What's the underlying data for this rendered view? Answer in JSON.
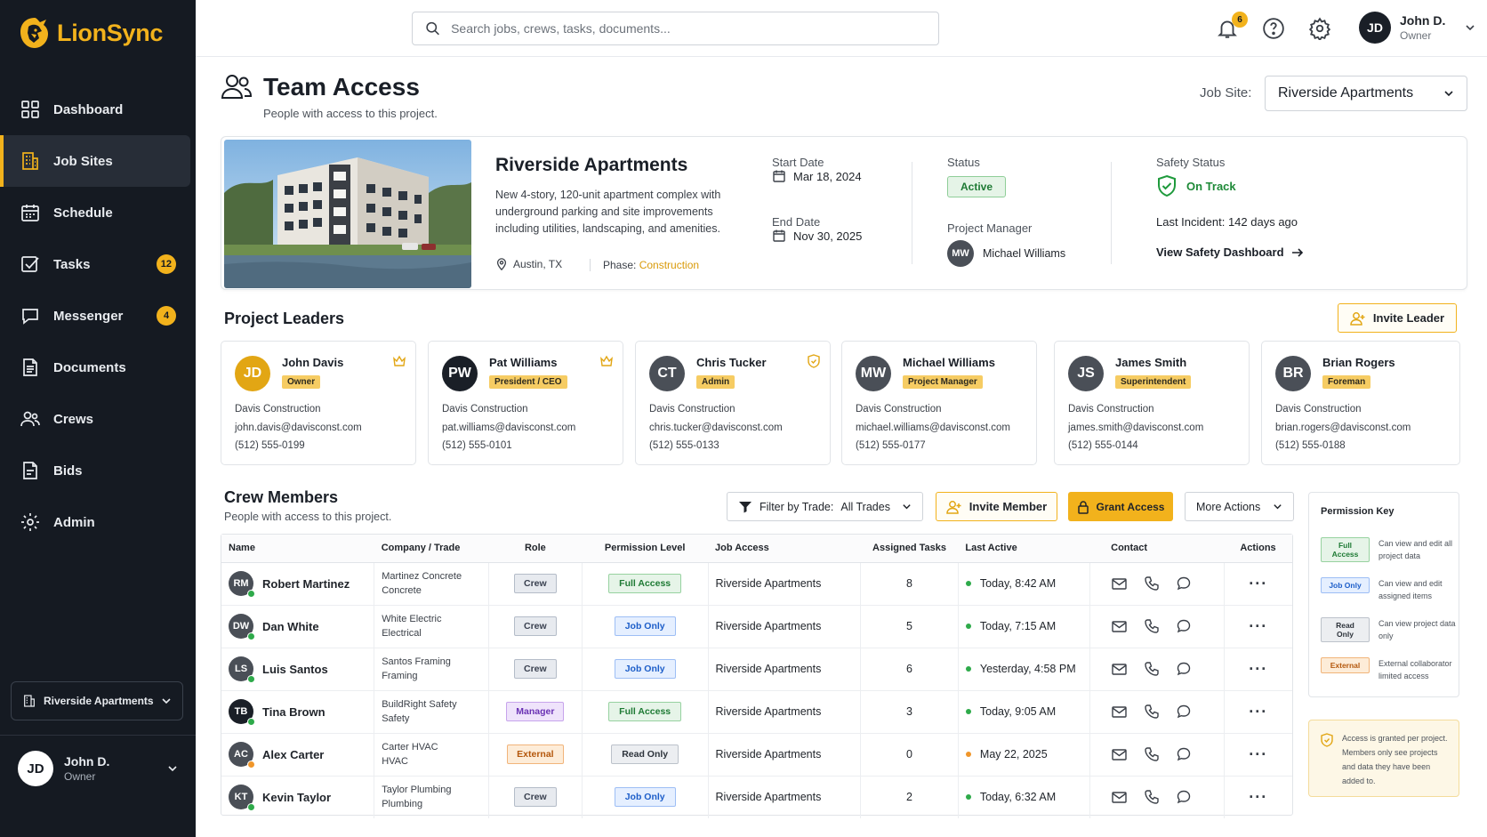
{
  "app": {
    "name": "LionSync"
  },
  "sidebar": {
    "items": [
      {
        "label": "Dashboard",
        "icon": "dashboard-icon"
      },
      {
        "label": "Job Sites",
        "icon": "building-icon",
        "active": true
      },
      {
        "label": "Schedule",
        "icon": "calendar-icon"
      },
      {
        "label": "Tasks",
        "icon": "checkbox-icon",
        "badge": "12"
      },
      {
        "label": "Messenger",
        "icon": "chat-icon",
        "badge": "4"
      },
      {
        "label": "Documents",
        "icon": "document-icon"
      },
      {
        "label": "Crews",
        "icon": "people-icon"
      },
      {
        "label": "Bids",
        "icon": "bid-icon"
      },
      {
        "label": "Admin",
        "icon": "gear-icon"
      }
    ],
    "site_switch": "Riverside Apartments",
    "user": {
      "initials": "JD",
      "name": "John D.",
      "role": "Owner"
    }
  },
  "topbar": {
    "search_placeholder": "Search jobs, crews, tasks, documents...",
    "notif_count": "6",
    "user": {
      "initials": "JD",
      "name": "John D.",
      "role": "Owner"
    }
  },
  "page": {
    "title": "Team Access",
    "subtitle": "People with access to this project.",
    "job_site_label": "Job Site:",
    "job_site_value": "Riverside Apartments"
  },
  "project": {
    "name": "Riverside Apartments",
    "description": "New 4-story, 120-unit apartment complex with underground parking and site improvements including utilities, landscaping, and amenities.",
    "location": "Austin, TX",
    "phase_label": "Phase:",
    "phase": "Construction",
    "start_label": "Start Date",
    "start": "Mar 18, 2024",
    "end_label": "End Date",
    "end": "Nov 30, 2025",
    "status_label": "Status",
    "status": "Active",
    "pm_label": "Project Manager",
    "pm_initials": "MW",
    "pm": "Michael Williams",
    "safety_label": "Safety Status",
    "safety": "On Track",
    "incident_label": "Last Incident:",
    "incident": "142 days ago",
    "safety_link": "View Safety Dashboard"
  },
  "leaders": {
    "title": "Project Leaders",
    "invite": "Invite Leader",
    "items": [
      {
        "initials": "JD",
        "name": "John Davis",
        "role": "Owner",
        "company": "Davis Construction",
        "email": "john.davis@davisconst.com",
        "phone": "(512) 555-0199",
        "badge_icon": "crown-icon",
        "color": "#e2a614"
      },
      {
        "initials": "PW",
        "name": "Pat Williams",
        "role": "President / CEO",
        "company": "Davis Construction",
        "email": "pat.williams@davisconst.com",
        "phone": "(512) 555-0101",
        "badge_icon": "crown-icon",
        "color": "#1a1f27"
      },
      {
        "initials": "CT",
        "name": "Chris Tucker",
        "role": "Admin",
        "company": "Davis Construction",
        "email": "chris.tucker@davisconst.com",
        "phone": "(512) 555-0133",
        "badge_icon": "shield-icon",
        "color": "#4a4f57"
      },
      {
        "initials": "MW",
        "name": "Michael Williams",
        "role": "Project Manager",
        "company": "Davis Construction",
        "email": "michael.williams@davisconst.com",
        "phone": "(512) 555-0177",
        "badge_icon": "",
        "color": "#4a4f57"
      },
      {
        "initials": "JS",
        "name": "James Smith",
        "role": "Superintendent",
        "company": "Davis Construction",
        "email": "james.smith@davisconst.com",
        "phone": "(512) 555-0144",
        "badge_icon": "",
        "color": "#4a4f57"
      },
      {
        "initials": "BR",
        "name": "Brian Rogers",
        "role": "Foreman",
        "company": "Davis Construction",
        "email": "brian.rogers@davisconst.com",
        "phone": "(512) 555-0188",
        "badge_icon": "",
        "color": "#4a4f57"
      }
    ]
  },
  "crew": {
    "title": "Crew Members",
    "subtitle": "People with access to this project.",
    "filter_label": "Filter by Trade:",
    "filter_value": "All Trades",
    "invite": "Invite Member",
    "grant": "Grant Access",
    "more": "More Actions",
    "columns": [
      "Name",
      "Company / Trade",
      "Role",
      "Permission Level",
      "Job Access",
      "Assigned Tasks",
      "Last Active",
      "Contact",
      "Actions"
    ],
    "rows": [
      {
        "initials": "RM",
        "name": "Robert Martinez",
        "company": "Martinez Concrete",
        "trade": "Concrete",
        "role": "Crew",
        "role_kind": "crew",
        "perm": "Full Access",
        "perm_kind": "full",
        "job": "Riverside Apartments",
        "tasks": "8",
        "last": "Today, 8:42 AM",
        "dot": "#2eaa4a"
      },
      {
        "initials": "DW",
        "name": "Dan White",
        "company": "White Electric",
        "trade": "Electrical",
        "role": "Crew",
        "role_kind": "crew",
        "perm": "Job Only",
        "perm_kind": "job",
        "job": "Riverside Apartments",
        "tasks": "5",
        "last": "Today, 7:15 AM",
        "dot": "#2eaa4a"
      },
      {
        "initials": "LS",
        "name": "Luis Santos",
        "company": "Santos Framing",
        "trade": "Framing",
        "role": "Crew",
        "role_kind": "crew",
        "perm": "Job Only",
        "perm_kind": "job",
        "job": "Riverside Apartments",
        "tasks": "6",
        "last": "Yesterday, 4:58 PM",
        "dot": "#2eaa4a"
      },
      {
        "initials": "TB",
        "name": "Tina Brown",
        "company": "BuildRight Safety",
        "trade": "Safety",
        "role": "Manager",
        "role_kind": "manager",
        "perm": "Full Access",
        "perm_kind": "full",
        "job": "Riverside Apartments",
        "tasks": "3",
        "last": "Today, 9:05 AM",
        "dot": "#2eaa4a"
      },
      {
        "initials": "AC",
        "name": "Alex Carter",
        "company": "Carter HVAC",
        "trade": "HVAC",
        "role": "External",
        "role_kind": "external",
        "perm": "Read Only",
        "perm_kind": "read",
        "job": "Riverside Apartments",
        "tasks": "0",
        "last": "May 22, 2025",
        "dot": "#f0962a"
      },
      {
        "initials": "KT",
        "name": "Kevin Taylor",
        "company": "Taylor Plumbing",
        "trade": "Plumbing",
        "role": "Crew",
        "role_kind": "crew",
        "perm": "Job Only",
        "perm_kind": "job",
        "job": "Riverside Apartments",
        "tasks": "2",
        "last": "Today, 6:32 AM",
        "dot": "#2eaa4a"
      }
    ]
  },
  "permission_key": {
    "title": "Permission Key",
    "items": [
      {
        "label": "Full Access",
        "kind": "full",
        "desc": "Can view and edit all project data"
      },
      {
        "label": "Job Only",
        "kind": "job",
        "desc": "Can view and edit assigned items"
      },
      {
        "label": "Read Only",
        "kind": "read",
        "desc": "Can view project data only"
      },
      {
        "label": "External",
        "kind": "external",
        "desc": "External collaborator limited access"
      }
    ],
    "note": "Access is granted per project. Members only see projects and data they have been added to."
  }
}
